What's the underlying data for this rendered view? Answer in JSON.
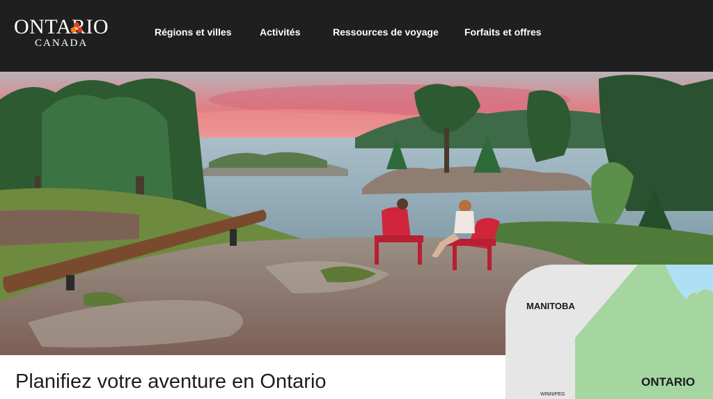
{
  "header": {
    "logo_main": "ONTARIO",
    "logo_sub": "CANADA",
    "nav": [
      {
        "label": "Régions et villes"
      },
      {
        "label": "Activités"
      },
      {
        "label": "Ressources de voyage"
      },
      {
        "label": "Forfaits et offres"
      }
    ]
  },
  "hero": {
    "scene": "Two people sitting in red Muskoka chairs on a rocky shore overlooking a lake at sunset"
  },
  "main": {
    "headline": "Planifiez votre aventure en Ontario"
  },
  "map": {
    "labels": {
      "manitoba": "MANITOBA",
      "ontario": "ONTARIO",
      "winnipeg": "WINNIPEG"
    }
  },
  "colors": {
    "header_bg": "#1f1f1f",
    "chair_red": "#d0253a",
    "map_ontario": "#a5d6a0",
    "map_water": "#aee0f5",
    "map_land": "#e6e6e6"
  }
}
